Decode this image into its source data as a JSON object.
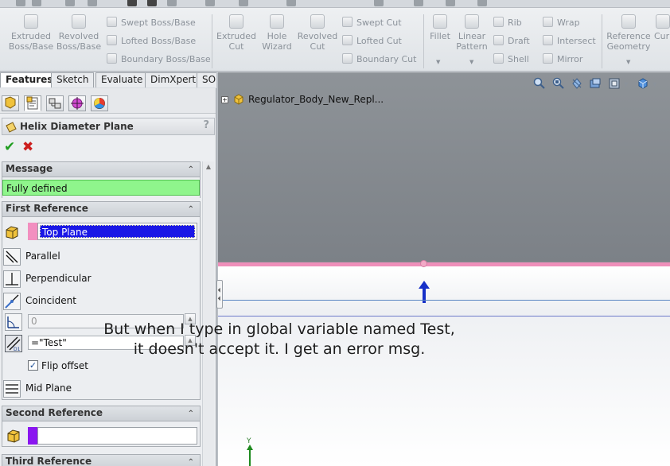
{
  "ribbon": {
    "features": {
      "extruded_boss": "Extruded\nBoss/Base",
      "revolved_boss": "Revolved\nBoss/Base",
      "swept_boss": "Swept Boss/Base",
      "lofted_boss": "Lofted Boss/Base",
      "boundary_boss": "Boundary Boss/Base",
      "extruded_cut": "Extruded\nCut",
      "hole_wizard": "Hole\nWizard",
      "revolved_cut": "Revolved\nCut",
      "swept_cut": "Swept Cut",
      "lofted_cut": "Lofted Cut",
      "boundary_cut": "Boundary Cut",
      "fillet": "Fillet",
      "linear_pattern": "Linear\nPattern",
      "rib": "Rib",
      "draft": "Draft",
      "shell": "Shell",
      "wrap": "Wrap",
      "intersect": "Intersect",
      "mirror": "Mirror",
      "reference_geometry": "Reference\nGeometry",
      "curves_partial": "Cur"
    }
  },
  "tabs": [
    "Features",
    "Sketch",
    "Evaluate",
    "DimXpert",
    "SOLIDWORKS Add-Ins"
  ],
  "tree": {
    "root": "Regulator_Body_New_Repl..."
  },
  "property_manager": {
    "title": "Helix Diameter Plane",
    "help": "?",
    "ok": "✔",
    "cancel": "✖",
    "message": {
      "header": "Message",
      "text": "Fully defined"
    },
    "first_reference": {
      "header": "First Reference",
      "selection": "Top Plane",
      "parallel": "Parallel",
      "perpendicular": "Perpendicular",
      "coincident": "Coincident",
      "angle_value": "0",
      "distance_value": "=\"Test\"",
      "flip_offset": "Flip offset",
      "mid_plane": "Mid Plane"
    },
    "second_reference": {
      "header": "Second Reference",
      "selection": ""
    },
    "third_reference": {
      "header": "Third Reference"
    }
  },
  "annotation": {
    "line1": "But when I type in global variable named Test,",
    "line2": "it doesn't accept it. I get an error msg."
  },
  "colors": {
    "first_ref_swatch": "#f28fc0",
    "second_ref_swatch": "#8a16f0",
    "message_bg": "#8ff58c",
    "selection_bg": "#1a17e6",
    "accept_green": "#1f9d1f",
    "cancel_red": "#cc1d1d"
  },
  "icons": {
    "tree_expand": "+",
    "collapse": "⌃",
    "check": "✓"
  }
}
